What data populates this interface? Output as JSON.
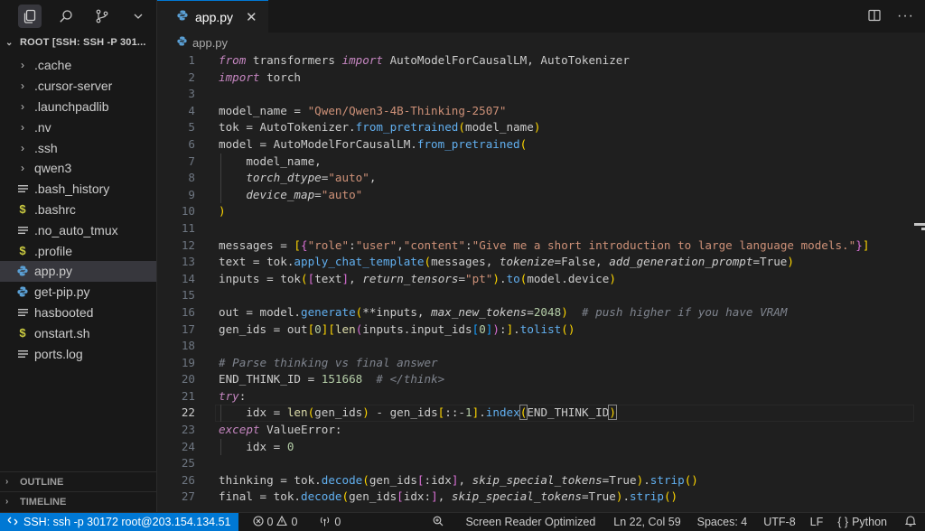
{
  "explorer": {
    "root_label": "ROOT [SSH: SSH -P 301...",
    "items": [
      {
        "label": ".cache",
        "kind": "folder",
        "icon": "chevron-right-icon"
      },
      {
        "label": ".cursor-server",
        "kind": "folder",
        "icon": "chevron-right-icon"
      },
      {
        "label": ".launchpadlib",
        "kind": "folder",
        "icon": "chevron-right-icon"
      },
      {
        "label": ".nv",
        "kind": "folder",
        "icon": "chevron-right-icon"
      },
      {
        "label": ".ssh",
        "kind": "folder",
        "icon": "chevron-right-icon"
      },
      {
        "label": "qwen3",
        "kind": "folder",
        "icon": "chevron-right-icon"
      },
      {
        "label": ".bash_history",
        "kind": "file",
        "icon": "file-lines-icon"
      },
      {
        "label": ".bashrc",
        "kind": "shell",
        "icon": "dollar-icon"
      },
      {
        "label": ".no_auto_tmux",
        "kind": "file",
        "icon": "file-lines-icon"
      },
      {
        "label": ".profile",
        "kind": "shell",
        "icon": "dollar-icon"
      },
      {
        "label": "app.py",
        "kind": "python",
        "icon": "python-icon",
        "active": true
      },
      {
        "label": "get-pip.py",
        "kind": "python",
        "icon": "python-icon"
      },
      {
        "label": "hasbooted",
        "kind": "file",
        "icon": "file-lines-icon"
      },
      {
        "label": "onstart.sh",
        "kind": "shell",
        "icon": "dollar-icon"
      },
      {
        "label": "ports.log",
        "kind": "file",
        "icon": "file-lines-icon"
      }
    ],
    "outline_label": "OUTLINE",
    "timeline_label": "TIMELINE"
  },
  "tab": {
    "label": "app.py"
  },
  "breadcrumb": {
    "file": "app.py"
  },
  "editor": {
    "current_line": 22,
    "line_numbers": [
      "1",
      "2",
      "3",
      "4",
      "5",
      "6",
      "7",
      "8",
      "9",
      "10",
      "11",
      "12",
      "13",
      "14",
      "15",
      "16",
      "17",
      "18",
      "19",
      "20",
      "21",
      "22",
      "23",
      "24",
      "25",
      "26",
      "27"
    ]
  },
  "status": {
    "remote": "SSH: ssh -p 30172 root@203.154.134.51",
    "errors": "0",
    "warnings": "0",
    "ports": "0",
    "screen_reader": "Screen Reader Optimized",
    "position": "Ln 22, Col 59",
    "spaces": "Spaces: 4",
    "encoding": "UTF-8",
    "eol": "LF",
    "language": "Python"
  },
  "colors": {
    "accent": "#0078d4",
    "background": "#1f1f1f",
    "sidebar": "#181818",
    "python_icon": "#5a9fd4",
    "shell_icon": "#cbcb41"
  }
}
